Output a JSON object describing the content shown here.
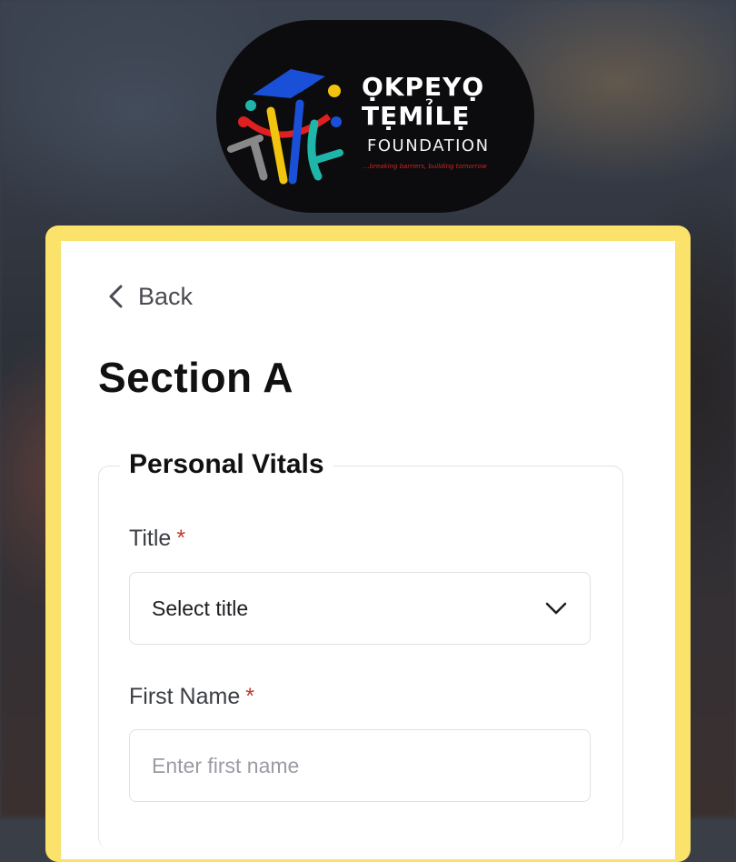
{
  "logo": {
    "line1": "ỌKPEYỌ",
    "line2": "TẸMỈLẸ",
    "line3": "FOUNDATION",
    "tagline": "...breaking barriers, building tomorrow"
  },
  "nav": {
    "back_label": "Back"
  },
  "page": {
    "title": "Section A"
  },
  "form": {
    "legend": "Personal Vitals",
    "fields": {
      "title": {
        "label": "Title",
        "required_mark": "*",
        "selected": "Select title"
      },
      "first_name": {
        "label": "First Name",
        "required_mark": "*",
        "placeholder": "Enter first name",
        "value": ""
      }
    }
  },
  "colors": {
    "card_border": "#fbe26a",
    "required": "#c0392b",
    "logo_background": "#0c0c0e"
  },
  "icons": {
    "back": "chevron-left-icon",
    "select": "chevron-down-icon"
  }
}
